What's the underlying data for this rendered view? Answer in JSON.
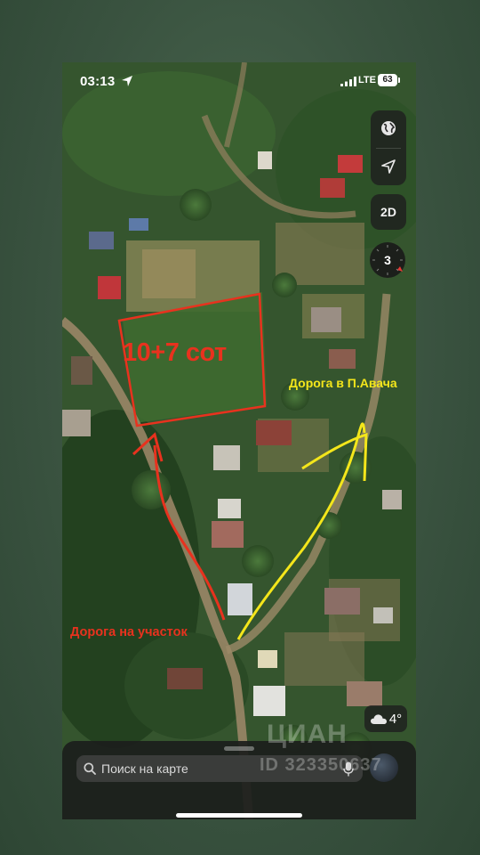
{
  "status_bar": {
    "time": "03:13",
    "network": "LTE",
    "battery": "63"
  },
  "map_controls": {
    "globe_icon": "globe-icon",
    "location_icon": "location-arrow-icon",
    "view_mode": "2D",
    "compass_value": "3"
  },
  "annotations": {
    "plot_label": "10+7 сот",
    "road_to_avacha": "Дорога в П.Авача",
    "road_to_plot": "Дорога на участок"
  },
  "annotation_colors": {
    "red": "#e8321e",
    "yellow": "#f4e61b"
  },
  "weather": {
    "icon": "cloud-icon",
    "temperature": "4°"
  },
  "search": {
    "placeholder": "Поиск на карте",
    "icon": "search-icon",
    "mic_icon": "mic-icon"
  },
  "watermark": {
    "brand": "ЦИАН",
    "listing_id": "ID 323350637"
  }
}
